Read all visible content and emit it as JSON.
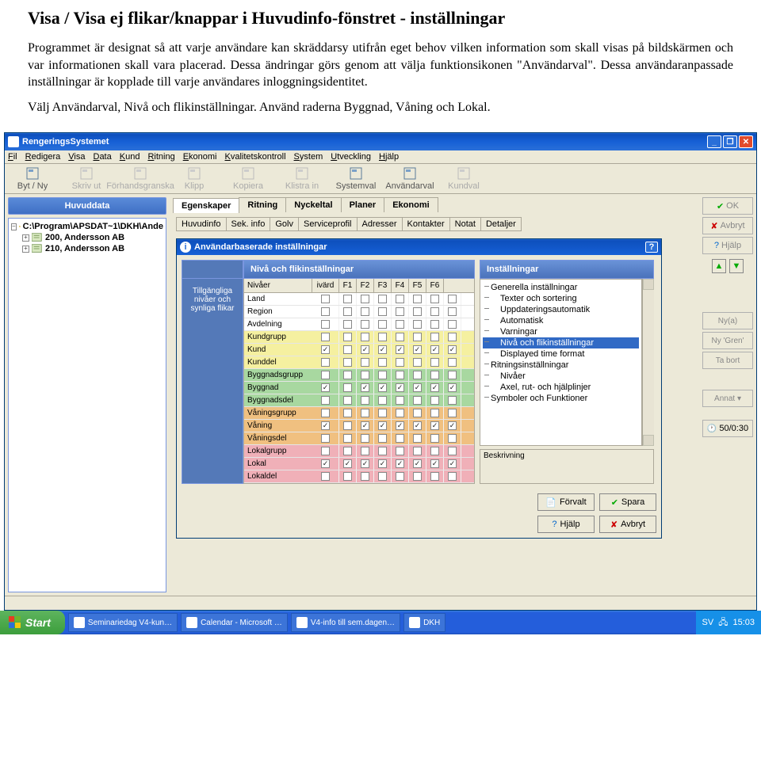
{
  "doc": {
    "title": "Visa / Visa ej flikar/knappar i Huvudinfo-fönstret - inställningar",
    "p1": "Programmet är designat så att varje användare kan skräddarsy utifrån eget behov vilken information som skall visas på bildskärmen och var informationen skall vara placerad. Dessa ändringar görs genom att välja funktionsikonen \"Användarval\". Dessa användaranpassade inställningar är kopplade till varje användares inloggningsidentitet.",
    "p2": "Välj Användarval, Nivå och flikinställningar. Använd raderna Byggnad, Våning och Lokal."
  },
  "app": {
    "title": "RengeringsSystemet"
  },
  "winbtns": [
    "_",
    "❐",
    "✕"
  ],
  "menu": [
    "Fil",
    "Redigera",
    "Visa",
    "Data",
    "Kund",
    "Ritning",
    "Ekonomi",
    "Kvalitetskontroll",
    "System",
    "Utveckling",
    "Hjälp"
  ],
  "toolbar": [
    {
      "label": "Byt / Ny",
      "dis": false
    },
    {
      "label": "Skriv ut",
      "dis": true
    },
    {
      "label": "Förhandsgranska",
      "dis": true
    },
    {
      "label": "Klipp",
      "dis": true
    },
    {
      "label": "Kopiera",
      "dis": true
    },
    {
      "label": "Klistra in",
      "dis": true
    },
    {
      "label": "Systemval",
      "dis": false
    },
    {
      "label": "Användarval",
      "dis": false
    },
    {
      "label": "Kundval",
      "dis": true
    }
  ],
  "leftpanel": {
    "title": "Huvuddata",
    "root": "C:\\Program\\APSDAT~1\\DKH\\Ande",
    "items": [
      "200, Andersson AB",
      "210, Andersson AB"
    ]
  },
  "maintabs": [
    "Egenskaper",
    "Ritning",
    "Nyckeltal",
    "Planer",
    "Ekonomi"
  ],
  "subtabs": [
    "Huvudinfo",
    "Sek. info",
    "Golv",
    "Serviceprofil",
    "Adresser",
    "Kontakter",
    "Notat",
    "Detaljer"
  ],
  "dialog": {
    "title": "Användarbaserade inställningar",
    "qmark": "?",
    "left_header": "Nivå och flikinställningar",
    "sidebar": "Tillgängliga nivåer och synliga flikar",
    "cols": [
      "Nivåer",
      "ivärd",
      "F1",
      "F2",
      "F3",
      "F4",
      "F5",
      "F6"
    ],
    "rows": [
      {
        "n": "Land",
        "c": "",
        "v": [
          0,
          0,
          0,
          0,
          0,
          0,
          0,
          0
        ]
      },
      {
        "n": "Region",
        "c": "",
        "v": [
          0,
          0,
          0,
          0,
          0,
          0,
          0,
          0
        ]
      },
      {
        "n": "Avdelning",
        "c": "",
        "v": [
          0,
          0,
          0,
          0,
          0,
          0,
          0,
          0
        ]
      },
      {
        "n": "Kundgrupp",
        "c": "c-yellow",
        "v": [
          0,
          0,
          0,
          0,
          0,
          0,
          0,
          0
        ]
      },
      {
        "n": "Kund",
        "c": "c-yellow",
        "v": [
          1,
          0,
          1,
          1,
          1,
          1,
          1,
          1
        ]
      },
      {
        "n": "Kunddel",
        "c": "c-yellow",
        "v": [
          0,
          0,
          0,
          0,
          0,
          0,
          0,
          0
        ]
      },
      {
        "n": "Byggnadsgrupp",
        "c": "c-green",
        "v": [
          0,
          0,
          0,
          0,
          0,
          0,
          0,
          0
        ]
      },
      {
        "n": "Byggnad",
        "c": "c-green",
        "v": [
          1,
          0,
          1,
          1,
          1,
          1,
          1,
          1
        ]
      },
      {
        "n": "Byggnadsdel",
        "c": "c-green",
        "v": [
          0,
          0,
          0,
          0,
          0,
          0,
          0,
          0
        ]
      },
      {
        "n": "Våningsgrupp",
        "c": "c-orange",
        "v": [
          0,
          0,
          0,
          0,
          0,
          0,
          0,
          0
        ]
      },
      {
        "n": "Våning",
        "c": "c-orange",
        "v": [
          1,
          0,
          1,
          1,
          1,
          1,
          1,
          1
        ]
      },
      {
        "n": "Våningsdel",
        "c": "c-orange",
        "v": [
          0,
          0,
          0,
          0,
          0,
          0,
          0,
          0
        ]
      },
      {
        "n": "Lokalgrupp",
        "c": "c-pink",
        "v": [
          0,
          0,
          0,
          0,
          0,
          0,
          0,
          0
        ]
      },
      {
        "n": "Lokal",
        "c": "c-pink",
        "v": [
          1,
          1,
          1,
          1,
          1,
          1,
          1,
          1
        ]
      },
      {
        "n": "Lokaldel",
        "c": "c-pink",
        "v": [
          0,
          0,
          0,
          0,
          0,
          0,
          0,
          0
        ]
      }
    ],
    "right_header": "Inställningar",
    "tree": [
      "Generella inställningar",
      "  Texter och sortering",
      "  Uppdateringsautomatik",
      "  Automatisk",
      "  Varningar",
      "  Nivå och flikinställningar",
      "  Displayed time format",
      "Ritningsinställningar",
      "  Nivåer",
      "  Axel, rut- och hjälplinjer",
      "Symboler och Funktioner"
    ],
    "tree_sel": 5,
    "beskr_label": "Beskrivning",
    "btns": {
      "forvalt": "Förvalt",
      "spara": "Spara",
      "hjalp": "Hjälp",
      "avbryt": "Avbryt"
    }
  },
  "sidebtns": {
    "ok": "OK",
    "avbryt": "Avbryt",
    "hjalp": "Hjälp",
    "nya": "Ny(a)",
    "nygren": "Ny 'Gren'",
    "tabort": "Ta bort",
    "annat": "Annat ▾",
    "status": "50/0:30"
  },
  "task": {
    "start": "Start",
    "items": [
      "Seminariedag V4-kun…",
      "Calendar - Microsoft …",
      "V4-info till sem.dagen…",
      "DKH"
    ],
    "lang": "SV",
    "time": "15:03"
  }
}
